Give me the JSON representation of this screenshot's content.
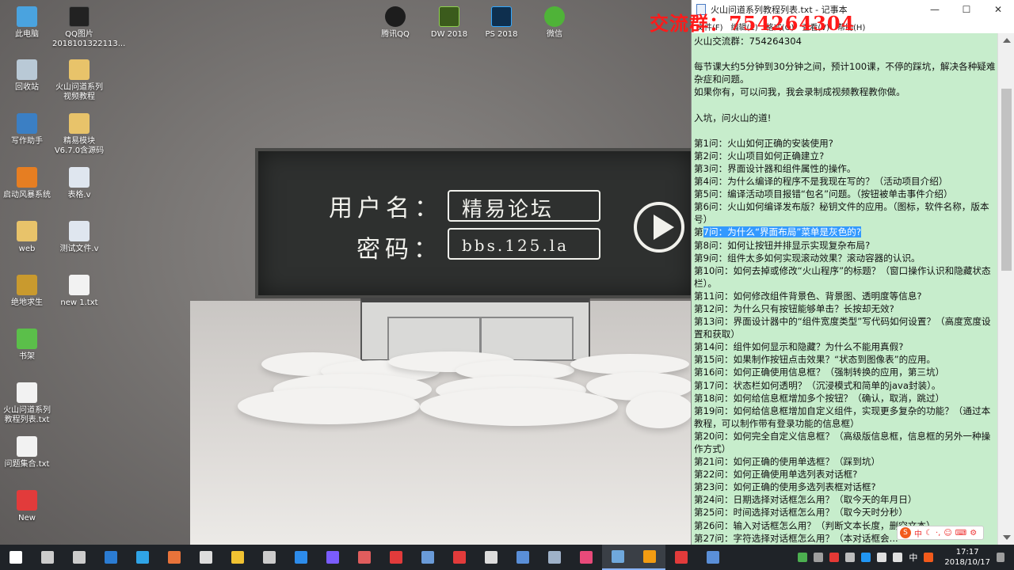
{
  "watermark": {
    "text": "交流群：754264304",
    "color": "#ff1a1a"
  },
  "desktop_icons": [
    {
      "label": "此电脑",
      "icon": "computer-icon",
      "color": "#4aa3df"
    },
    {
      "label": "QQ图片2018101322113...",
      "icon": "image-file-icon",
      "color": "#222222"
    },
    {
      "label": "回收站",
      "icon": "recycle-bin-icon",
      "color": "#b9c9d6"
    },
    {
      "label": "火山问道系列视频教程",
      "icon": "folder-icon",
      "color": "#e8c36a"
    },
    {
      "label": "写作助手",
      "icon": "pen-icon",
      "color": "#3b7fc4"
    },
    {
      "label": "精易模块V6.7.0含源码",
      "icon": "folder-icon",
      "color": "#e8c36a"
    },
    {
      "label": "启动风暴系统",
      "icon": "app-icon",
      "color": "#e67e22"
    },
    {
      "label": "表格.v",
      "icon": "v-file-icon",
      "color": "#dfe6ef"
    },
    {
      "label": "web",
      "icon": "folder-icon",
      "color": "#e8c36a"
    },
    {
      "label": "测试文件.v",
      "icon": "v-file-icon",
      "color": "#dfe6ef"
    },
    {
      "label": "绝地求生",
      "icon": "game-icon",
      "color": "#c99a2e"
    },
    {
      "label": "new 1.txt",
      "icon": "text-file-icon",
      "color": "#f2f2f2"
    },
    {
      "label": "书架",
      "icon": "bookshelf-icon",
      "color": "#5bbf4a"
    },
    {
      "label": "火山问道系列教程列表.txt",
      "icon": "text-file-icon",
      "color": "#f2f2f2"
    },
    {
      "label": "问题集合.txt",
      "icon": "text-file-icon",
      "color": "#f2f2f2"
    },
    {
      "label": "New",
      "icon": "app-icon",
      "color": "#e23b3b"
    },
    {
      "label": "腾讯QQ",
      "icon": "qq-icon",
      "color": "#1d1d1d"
    },
    {
      "label": "DW 2018",
      "icon": "dreamweaver-icon",
      "color": "#3b5b1c"
    },
    {
      "label": "PS 2018",
      "icon": "photoshop-icon",
      "color": "#0e2f4e"
    },
    {
      "label": "微信",
      "icon": "wechat-icon",
      "color": "#4fb338"
    }
  ],
  "wallpaper": {
    "username_label": "用户名：",
    "username_value": "精易论坛",
    "password_label": "密码：",
    "password_value": "bbs.125.la"
  },
  "notepad": {
    "title": "火山问道系列教程列表.txt - 记事本",
    "menu": [
      "文件(F)",
      "编辑(E)",
      "格式(O)",
      "查看(V)",
      "帮助(H)"
    ],
    "lines": [
      "火山交流群：754264304",
      "",
      "每节课大约5分钟到30分钟之间，预计100课，不停的踩坑，解决各种疑难杂症和问题。",
      "如果你有，可以问我，我会录制成视频教程教你做。",
      "",
      "入坑，问火山的道!",
      "",
      "第1问：火山如何正确的安装使用?",
      "第2问：火山项目如何正确建立?",
      "第3问：界面设计器和组件属性的操作。",
      "第4问：为什么编译的程序不是我现在写的？（活动项目介绍）",
      "第5问：编译活动项目报错“包名”问题。（按钮被单击事件介绍）",
      "第6问：火山如何编译发布版？秘钥文件的应用。（图标，软件名称，版本号）",
      "第7问：为什么“界面布局”菜单是灰色的?",
      "第8问：如何让按钮并排显示实现复杂布局?",
      "第9问：组件太多如何实现滚动效果？滚动容器的认识。",
      "第10问：如何去掉或修改“火山程序”的标题？（窗口操作认识和隐藏状态栏）。",
      "第11问：如何修改组件背景色、背景图、透明度等信息?",
      "第12问：为什么只有按钮能够单击？长按却无效?",
      "第13问：界面设计器中的“组件宽度类型”写代码如何设置？（高度宽度设置和获取）",
      "第14问：组件如何显示和隐藏？为什么不能用真假?",
      "第15问：如果制作按钮点击效果？“状态到图像表”的应用。",
      "第16问：如何正确使用信息框？（强制转换的应用，第三坑）",
      "第17问：状态栏如何透明？（沉浸模式和简单的java封装）。",
      "第18问：如何给信息框增加多个按钮？（确认，取消，跳过）",
      "第19问：如何给信息框增加自定义组件，实现更多复杂的功能？（通过本教程，可以制作带有登录功能的信息框）",
      "第20问：如何完全自定义信息框？（高级版信息框，信息框的另外一种操作方式）",
      "第21问：如何正确的使用单选框？（踩到坑）",
      "第22问：如何正确使用单选列表对话框?",
      "第23问：如何正确的使用多选列表框对话框?",
      "第24问：日期选择对话框怎么用？（取今天的年月日）",
      "第25问：时间选择对话框怎么用？（取今天时分秒）",
      "第26问：输入对话框怎么用？（判断文本长度，删空文本）",
      "第27问：字符选择对话框怎么用？（本对话框会..."
    ],
    "selected_line_prefix": "第",
    "selected_line_highlight": "7问：为什么“界面布局”菜单是灰色的?",
    "body_color": "#c7edcc",
    "highlight_color": "#3399ff"
  },
  "ime": {
    "label": "中"
  },
  "taskbar": {
    "apps": [
      {
        "name": "start-button",
        "icon": "windows-icon",
        "color": "#ffffff"
      },
      {
        "name": "app-cortana",
        "icon": "cortana-icon",
        "color": "#cccccc"
      },
      {
        "name": "app-task-view",
        "icon": "task-view-icon",
        "color": "#cccccc"
      },
      {
        "name": "app-edge",
        "icon": "edge-icon",
        "color": "#2b7cd3"
      },
      {
        "name": "app-ie",
        "icon": "ie-icon",
        "color": "#2fa4e7"
      },
      {
        "name": "app-firefox",
        "icon": "browser-icon",
        "color": "#e8733a"
      },
      {
        "name": "app-e-lang",
        "icon": "e-lang-icon",
        "color": "#dddddd"
      },
      {
        "name": "app-notes",
        "icon": "notes-icon",
        "color": "#f1c232"
      },
      {
        "name": "app-calculator",
        "icon": "calculator-icon",
        "color": "#cccccc"
      },
      {
        "name": "app-teamviewer",
        "icon": "remote-icon",
        "color": "#2d8ceb"
      },
      {
        "name": "app-game",
        "icon": "game-icon",
        "color": "#7a5cff"
      },
      {
        "name": "app-image",
        "icon": "image-icon",
        "color": "#e05d5d"
      },
      {
        "name": "app-tool-a",
        "icon": "mountain-icon",
        "color": "#e23b3b"
      },
      {
        "name": "app-tool-m",
        "icon": "m-icon",
        "color": "#6a9bd8"
      },
      {
        "name": "app-tool-v",
        "icon": "v-icon",
        "color": "#e23b3b"
      },
      {
        "name": "app-capture",
        "icon": "capture-icon",
        "color": "#dddddd"
      },
      {
        "name": "app-network",
        "icon": "network-icon",
        "color": "#5a8fd8"
      },
      {
        "name": "app-steam",
        "icon": "steam-icon",
        "color": "#9fb2c9"
      },
      {
        "name": "app-recorder",
        "icon": "record-icon",
        "color": "#e84a7a"
      },
      {
        "name": "app-notepad",
        "icon": "notepad-icon",
        "color": "#6fa8dc",
        "active": true
      },
      {
        "name": "app-orange",
        "icon": "app-icon",
        "color": "#f39c12",
        "active": true
      },
      {
        "name": "app-tool-a2",
        "icon": "mountain-icon",
        "color": "#e23b3b"
      },
      {
        "name": "app-tool-a3",
        "icon": "mountain-icon",
        "color": "#5a8fd8"
      }
    ],
    "tray_lang": "中",
    "clock_time": "17:17",
    "clock_date": "2018/10/17"
  }
}
